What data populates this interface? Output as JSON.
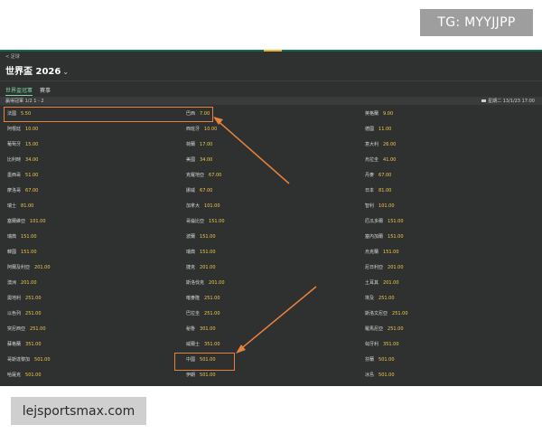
{
  "tg_badge": "TG: MYYJJPP",
  "site_watermark": "lejsportsmax.com",
  "breadcrumb": "< 足球",
  "page_title": "世界盃 2026",
  "tabs": [
    {
      "label": "世界盃冠軍",
      "active": true
    },
    {
      "label": "賽事",
      "active": false
    }
  ],
  "subbar": {
    "left": "贏得冠軍 1/2 1 - 2",
    "right": "星期二 13/1/23 17:00"
  },
  "colors": {
    "background": "#2f3030",
    "accent_green": "#7fd3a4",
    "odds_yellow": "#f2c94c",
    "highlight_orange": "#e8823a"
  },
  "odds_grid": [
    {
      "team": "法國",
      "odds": "5.50"
    },
    {
      "team": "巴西",
      "odds": "7.00"
    },
    {
      "team": "英格蘭",
      "odds": "9.00"
    },
    {
      "team": "阿根廷",
      "odds": "10.00"
    },
    {
      "team": "西班牙",
      "odds": "10.00"
    },
    {
      "team": "德國",
      "odds": "11.00"
    },
    {
      "team": "葡萄牙",
      "odds": "15.00"
    },
    {
      "team": "荷蘭",
      "odds": "17.00"
    },
    {
      "team": "意大利",
      "odds": "26.00"
    },
    {
      "team": "比利時",
      "odds": "34.00"
    },
    {
      "team": "美國",
      "odds": "34.00"
    },
    {
      "team": "烏拉圭",
      "odds": "41.00"
    },
    {
      "team": "墨西哥",
      "odds": "51.00"
    },
    {
      "team": "克羅地亞",
      "odds": "67.00"
    },
    {
      "team": "丹麥",
      "odds": "67.00"
    },
    {
      "team": "摩洛哥",
      "odds": "67.00"
    },
    {
      "team": "挪威",
      "odds": "67.00"
    },
    {
      "team": "日本",
      "odds": "81.00"
    },
    {
      "team": "瑞士",
      "odds": "81.00"
    },
    {
      "team": "加拿大",
      "odds": "101.00"
    },
    {
      "team": "智利",
      "odds": "101.00"
    },
    {
      "team": "塞爾維亞",
      "odds": "101.00"
    },
    {
      "team": "哥倫比亞",
      "odds": "151.00"
    },
    {
      "team": "厄瓜多爾",
      "odds": "151.00"
    },
    {
      "team": "瑞典",
      "odds": "151.00"
    },
    {
      "team": "波蘭",
      "odds": "151.00"
    },
    {
      "team": "塞內加爾",
      "odds": "151.00"
    },
    {
      "team": "韓國",
      "odds": "151.00"
    },
    {
      "team": "瑞典",
      "odds": "151.00"
    },
    {
      "team": "烏克蘭",
      "odds": "151.00"
    },
    {
      "team": "阿爾及利亞",
      "odds": "201.00"
    },
    {
      "team": "捷克",
      "odds": "201.00"
    },
    {
      "team": "尼日利亞",
      "odds": "201.00"
    },
    {
      "team": "澳洲",
      "odds": "201.00"
    },
    {
      "team": "斯洛伐克",
      "odds": "201.00"
    },
    {
      "team": "土耳其",
      "odds": "201.00"
    },
    {
      "team": "奧地利",
      "odds": "251.00"
    },
    {
      "team": "喀麥隆",
      "odds": "251.00"
    },
    {
      "team": "埃及",
      "odds": "251.00"
    },
    {
      "team": "以色列",
      "odds": "251.00"
    },
    {
      "team": "巴拉圭",
      "odds": "251.00"
    },
    {
      "team": "斯洛文尼亞",
      "odds": "251.00"
    },
    {
      "team": "突尼西亞",
      "odds": "251.00"
    },
    {
      "team": "秘魯",
      "odds": "301.00"
    },
    {
      "team": "羅馬尼亞",
      "odds": "251.00"
    },
    {
      "team": "蘇格蘭",
      "odds": "351.00"
    },
    {
      "team": "威爾士",
      "odds": "351.00"
    },
    {
      "team": "匈牙利",
      "odds": "351.00"
    },
    {
      "team": "哥斯達黎加",
      "odds": "501.00"
    },
    {
      "team": "中國",
      "odds": "501.00"
    },
    {
      "team": "芬蘭",
      "odds": "501.00"
    },
    {
      "team": "哈薩克",
      "odds": "501.00"
    },
    {
      "team": "伊朗",
      "odds": "501.00"
    },
    {
      "team": "冰島",
      "odds": "501.00"
    }
  ]
}
